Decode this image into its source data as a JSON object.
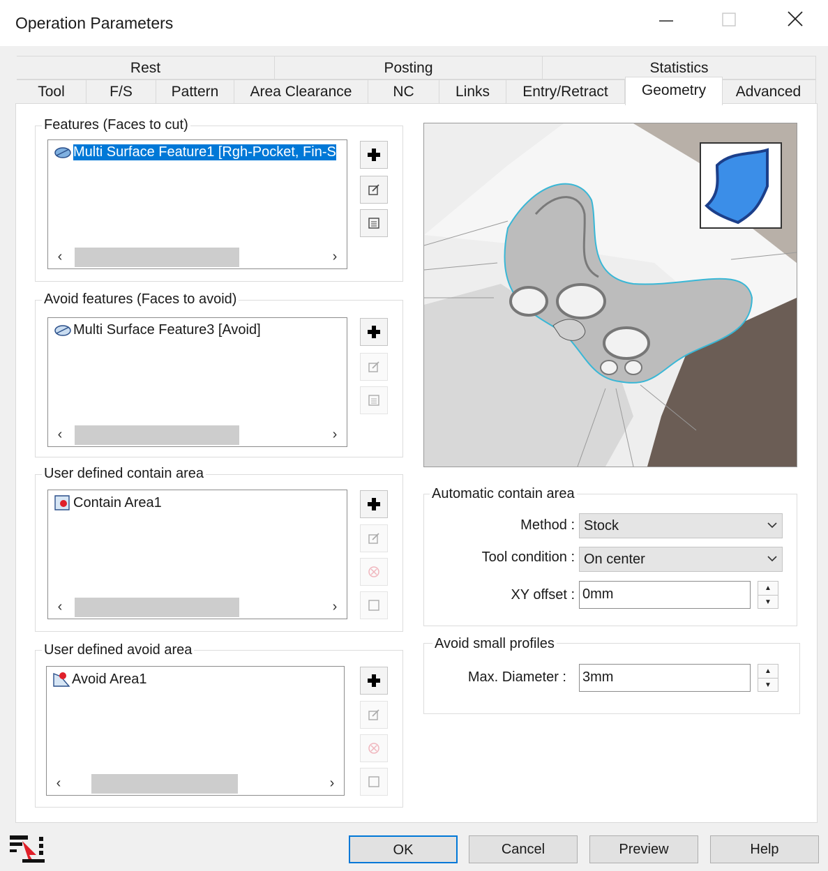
{
  "window": {
    "title": "Operation Parameters",
    "minimize_icon": "minimize-icon",
    "maximize_icon": "maximize-icon",
    "close_icon": "close-icon"
  },
  "tabs": {
    "row1": [
      {
        "label": "Rest"
      },
      {
        "label": "Posting"
      },
      {
        "label": "Statistics"
      }
    ],
    "row2": [
      {
        "label": "Tool"
      },
      {
        "label": "F/S"
      },
      {
        "label": "Pattern"
      },
      {
        "label": "Area Clearance"
      },
      {
        "label": "NC"
      },
      {
        "label": "Links"
      },
      {
        "label": "Entry/Retract"
      },
      {
        "label": "Geometry"
      },
      {
        "label": "Advanced"
      }
    ],
    "active": "Geometry"
  },
  "features": {
    "label": "Features (Faces to cut)",
    "items": [
      {
        "text": "Multi Surface Feature1 [Rgh-Pocket, Fin-S",
        "icon": "surface-feature-icon",
        "selected": true
      }
    ]
  },
  "avoid_features": {
    "label": "Avoid features (Faces to avoid)",
    "items": [
      {
        "text": "Multi Surface Feature3 [Avoid]",
        "icon": "surface-feature-icon"
      }
    ]
  },
  "contain_area": {
    "label": "User defined contain area",
    "items": [
      {
        "text": "Contain Area1",
        "icon": "contain-area-icon"
      }
    ]
  },
  "avoid_area": {
    "label": "User defined avoid area",
    "items": [
      {
        "text": "Avoid Area1",
        "icon": "avoid-area-icon"
      }
    ]
  },
  "automatic_contain": {
    "label": "Automatic contain area",
    "method_label": "Method :",
    "method_value": "Stock",
    "tool_condition_label": "Tool condition :",
    "tool_condition_value": "On center",
    "xy_offset_label": "XY offset :",
    "xy_offset_value": "0mm"
  },
  "avoid_small": {
    "label": "Avoid small profiles",
    "max_diameter_label": "Max. Diameter :",
    "max_diameter_value": "3mm"
  },
  "buttons": {
    "ok": "OK",
    "cancel": "Cancel",
    "preview": "Preview",
    "help": "Help"
  },
  "colors": {
    "selection": "#0078d7",
    "background": "#f0f0f0",
    "panel": "#ffffff"
  }
}
